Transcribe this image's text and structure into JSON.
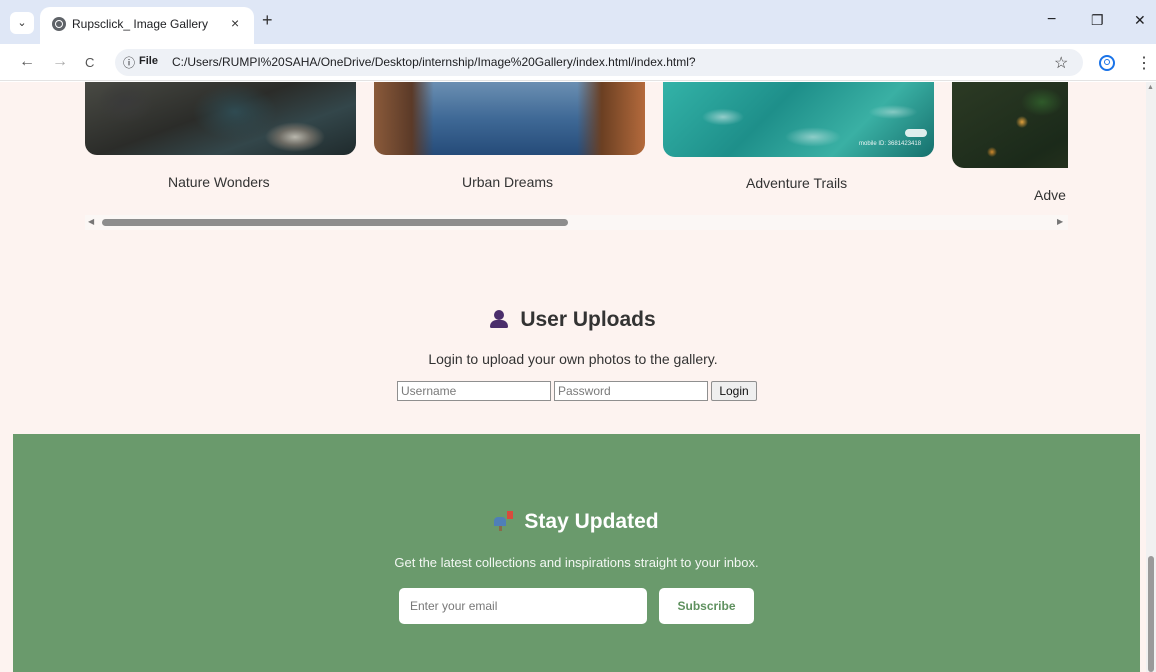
{
  "browser": {
    "tab_title": "Rupsclick_ Image Gallery",
    "tab_close": "×",
    "new_tab": "+",
    "tab_menu_icon": "⌄",
    "address_info_icon": "ⓘ",
    "address_scheme": "File",
    "url": "C:/Users/RUMPI%20SAHA/OneDrive/Desktop/internship/Image%20Gallery/index.html/index.html?",
    "nav_back": "←",
    "nav_forward": "→",
    "nav_reload": "C",
    "bookmark_icon": "☆",
    "menu_icon": "⋮",
    "minimize": "−",
    "restore": "❐",
    "close": "✕"
  },
  "gallery": {
    "cards": [
      {
        "caption": "Nature Wonders",
        "image": "nature-rocks-water"
      },
      {
        "caption": "Urban Dreams",
        "image": "canyon-reflection"
      },
      {
        "caption": "Adventure Trails",
        "image": "turquoise-water"
      },
      {
        "caption": "Adve",
        "image": "forest-lights"
      }
    ],
    "watermark": "mobile ID: 3681423418",
    "scroll_left_arrow": "◀",
    "scroll_right_arrow": "▶"
  },
  "uploads": {
    "title": "User Uploads",
    "description": "Login to upload your own photos to the gallery.",
    "username_placeholder": "Username",
    "password_placeholder": "Password",
    "login_label": "Login"
  },
  "newsletter": {
    "title": "Stay Updated",
    "description": "Get the latest collections and inspirations straight to your inbox.",
    "email_placeholder": "Enter your email",
    "subscribe_label": "Subscribe"
  },
  "colors": {
    "page_background": "#fdf3f0",
    "newsletter_green": "#6a9a6c",
    "subscribe_text": "#5f915f",
    "chrome_tab_bar": "#dfe7f6"
  }
}
